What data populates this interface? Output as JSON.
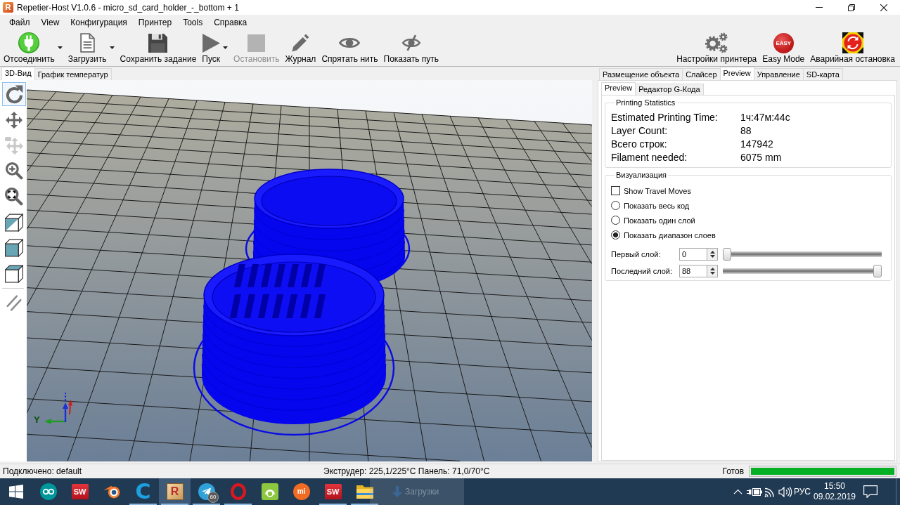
{
  "window": {
    "icon_text": "R",
    "title": "Repetier-Host V1.0.6 - micro_sd_card_holder_-_bottom + 1"
  },
  "menu": [
    {
      "label": "Файл"
    },
    {
      "label": "View"
    },
    {
      "label": "Конфигурация"
    },
    {
      "label": "Принтер"
    },
    {
      "label": "Tools"
    },
    {
      "label": "Справка"
    }
  ],
  "toolbar": {
    "left": [
      {
        "kind": "plug",
        "label": "Отсоединить",
        "dropdown": true,
        "disabled": false
      },
      {
        "kind": "document",
        "label": "Загрузить",
        "dropdown": true,
        "disabled": false
      },
      {
        "kind": "floppy",
        "label": "Сохранить задание",
        "dropdown": false,
        "disabled": false
      },
      {
        "kind": "play",
        "label": "Пуск",
        "dropdown": true,
        "disabled": false
      },
      {
        "kind": "stop",
        "label": "Остановить",
        "dropdown": false,
        "disabled": true
      },
      {
        "kind": "pencil",
        "label": "Журнал",
        "dropdown": false,
        "disabled": false
      },
      {
        "kind": "eye",
        "label": "Спрятать нить",
        "dropdown": false,
        "disabled": false
      },
      {
        "kind": "eye-slash",
        "label": "Показать путь",
        "dropdown": false,
        "disabled": false
      }
    ],
    "right": [
      {
        "kind": "gears",
        "label": "Настройки принтера"
      },
      {
        "kind": "easy",
        "label": "Easy Mode",
        "icon_text": "EASY"
      },
      {
        "kind": "emergency",
        "label": "Аварийная остановка"
      }
    ]
  },
  "view_tabs": [
    {
      "label": "3D-Вид",
      "selected": true
    },
    {
      "label": "График температур",
      "selected": false
    }
  ],
  "view_tools": [
    [
      {
        "kind": "rotate",
        "selected": true,
        "disabled": false
      },
      {
        "kind": "move",
        "selected": false,
        "disabled": false
      },
      {
        "kind": "move-object",
        "selected": false,
        "disabled": true
      },
      {
        "kind": "zoom",
        "selected": false,
        "disabled": false
      },
      {
        "kind": "fit",
        "selected": false,
        "disabled": false
      },
      {
        "kind": "iso-view",
        "selected": false,
        "disabled": false
      },
      {
        "kind": "front-view",
        "selected": false,
        "disabled": false
      },
      {
        "kind": "top-view",
        "selected": false,
        "disabled": false
      }
    ],
    [
      {
        "kind": "parallel",
        "selected": false,
        "disabled": false
      }
    ]
  ],
  "viewport": {
    "axis_label": "Y"
  },
  "panel_tabs": [
    {
      "label": "Размещение объекта",
      "selected": false
    },
    {
      "label": "Слайсер",
      "selected": false
    },
    {
      "label": "Preview",
      "selected": true
    },
    {
      "label": "Управление",
      "selected": false
    },
    {
      "label": "SD-карта",
      "selected": false
    }
  ],
  "preview_tabs": [
    {
      "label": "Preview",
      "selected": true
    },
    {
      "label": "Редактор G-Кода",
      "selected": false
    }
  ],
  "statistics": {
    "title": "Printing Statistics",
    "rows": [
      {
        "label": "Estimated Printing Time:",
        "value": "1ч:47м:44с"
      },
      {
        "label": "Layer Count:",
        "value": "88"
      },
      {
        "label": "Всего строк:",
        "value": "147942"
      },
      {
        "label": "Filament needed:",
        "value": "6075 mm"
      }
    ]
  },
  "visualization": {
    "title": "Визуализация",
    "options": [
      {
        "kind": "checkbox",
        "label": "Show Travel Moves",
        "checked": false
      },
      {
        "kind": "radio",
        "label": "Показать весь код",
        "selected": false
      },
      {
        "kind": "radio",
        "label": "Показать один слой",
        "selected": false
      },
      {
        "kind": "radio",
        "label": "Показать диапазон слоев",
        "selected": true
      }
    ],
    "layers": [
      {
        "label": "Первый слой:",
        "value": "0",
        "level": 0
      },
      {
        "label": "Последний слой:",
        "value": "88",
        "level": 1
      }
    ]
  },
  "status_bar": {
    "connection": "Подключено: default",
    "temperatures": "Экструдер: 225,1/225°C Панель: 71,0/70°C",
    "state": "Готов",
    "progress": {
      "level": 1
    }
  },
  "taskbar": {
    "apps": [
      {
        "kind": "infinity-logo",
        "selected": false,
        "running": false
      },
      {
        "kind": "sw-logo",
        "text": "SW",
        "selected": false,
        "running": false
      },
      {
        "kind": "orbit-logo",
        "selected": false,
        "running": false
      },
      {
        "kind": "c-logo",
        "text": "C",
        "selected": false,
        "running": true
      },
      {
        "kind": "r-logo",
        "text": "R",
        "selected": true,
        "running": true
      },
      {
        "kind": "plane-logo",
        "badge": "60",
        "selected": false,
        "running": true
      },
      {
        "kind": "ring-logo",
        "selected": false,
        "running": true
      },
      {
        "kind": "robot-tile",
        "selected": false,
        "running": false
      },
      {
        "kind": "mi-logo",
        "text": "mi",
        "selected": false,
        "running": false
      },
      {
        "kind": "sw-logo",
        "text": "SW",
        "selected": false,
        "running": true
      },
      {
        "kind": "folder",
        "selected": false,
        "running": true
      }
    ],
    "drag_preview": {
      "label": "Загрузки"
    },
    "tray": {
      "language": "РУС",
      "time": "15:50",
      "date": "09.02.2019"
    }
  }
}
